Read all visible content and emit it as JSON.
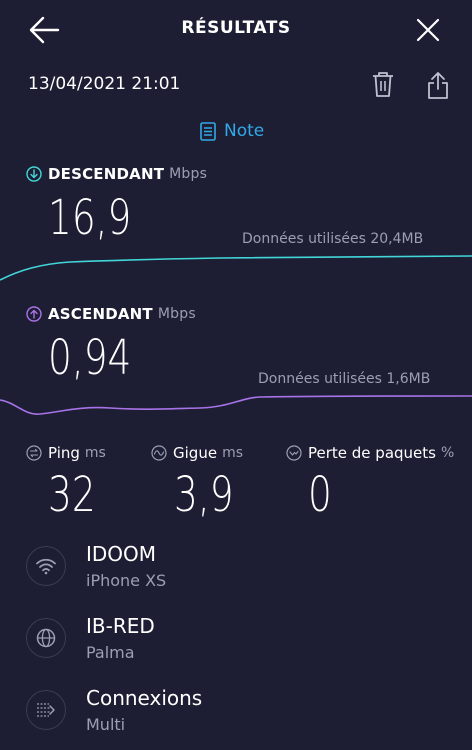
{
  "header": {
    "title": "RÉSULTATS"
  },
  "test": {
    "datetime": "13/04/2021 21:01"
  },
  "note": {
    "label": "Note"
  },
  "download": {
    "label": "DESCENDANT",
    "unit": "Mbps",
    "value": "16,9",
    "data_used": "Données utilisées 20,4MB",
    "color": "#41d6d8"
  },
  "upload": {
    "label": "ASCENDANT",
    "unit": "Mbps",
    "value": "0,94",
    "data_used": "Données utilisées 1,6MB",
    "color": "#a873e8"
  },
  "stats": {
    "ping": {
      "label": "Ping",
      "unit": "ms",
      "value": "32"
    },
    "jitter": {
      "label": "Gigue",
      "unit": "ms",
      "value": "3,9"
    },
    "loss": {
      "label": "Perte de paquets",
      "unit": "%",
      "value": "0"
    }
  },
  "connection": {
    "wifi": {
      "title": "IDOOM",
      "subtitle": "iPhone XS",
      "icon": "wifi-icon"
    },
    "server": {
      "title": "IB-RED",
      "subtitle": "Palma",
      "icon": "globe-icon"
    },
    "connections": {
      "title": "Connexions",
      "subtitle": "Multi",
      "icon": "multi-connection-icon"
    }
  },
  "colors": {
    "background": "#1d1e33",
    "accent_blue": "#31a9e8",
    "muted_text": "#9c9fb3"
  }
}
